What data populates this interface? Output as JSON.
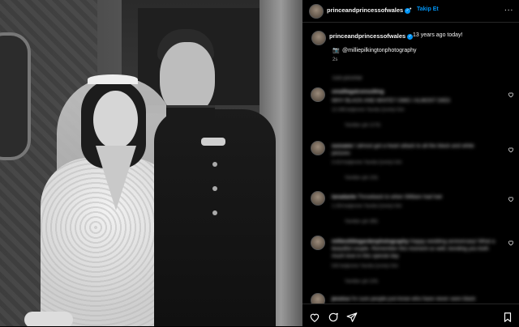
{
  "header": {
    "username": "princeandprincessofwales",
    "separator": "•",
    "follow_label": "Takip Et",
    "more_label": "..."
  },
  "caption": {
    "username": "princeandprincessofwales",
    "text": "13 years ago today!",
    "credit_emoji": "📷",
    "credit": "@milliepilkingtonphotography",
    "time": "2s"
  },
  "comments": [
    {
      "username": "smalllegalconsulting",
      "text": "WHY BLACK AND WHITE? OMG I ALMOST DIED",
      "meta": "12.348 beğenme   Yanıtla   Çeviriyi Gör",
      "replies": "Yanıtları gör (173)"
    },
    {
      "username": "sussane",
      "text": "I almost got a heart attack to all the black and white pictures",
      "meta": "3.414 beğenme   Yanıtla   Çeviriyi Gör",
      "replies": "Yanıtları gör (16)"
    },
    {
      "username": "lanadante",
      "text": "Throwback to when William had hair",
      "meta": "1.234 beğenme   Yanıtla   Çeviriyi Gör",
      "replies": "Yanıtları gör (85)"
    },
    {
      "username": "millieslittlegardenphotography",
      "text": "Happy wedding anniversary! What a beautiful couple. Remember this moment so well, bonding you both much love in this special day",
      "meta": "543 beğenme   Yanıtla   Çeviriyi Gör",
      "replies": "Yanıtları gör (24)"
    },
    {
      "username": "jessica",
      "text": "I'm sure people just know who have never seen black",
      "meta": "",
      "replies": ""
    }
  ],
  "footer": {
    "icons": [
      "heart-icon",
      "comment-icon",
      "share-icon",
      "bookmark-icon"
    ]
  },
  "colors": {
    "accent": "#0095f6",
    "background": "#000000"
  }
}
